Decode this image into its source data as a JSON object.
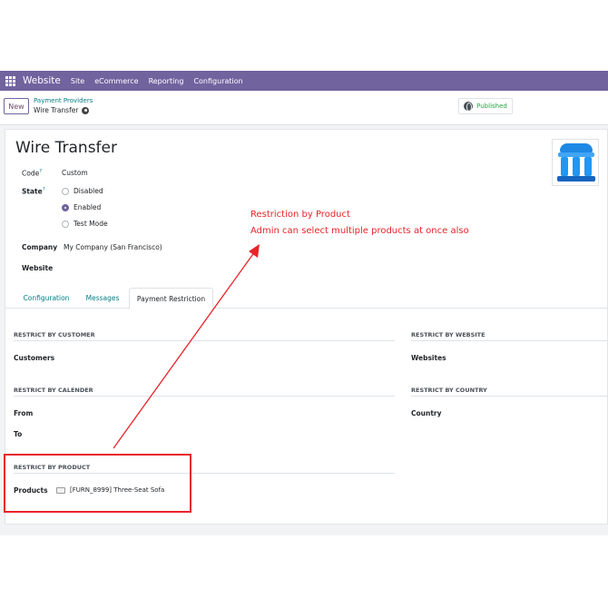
{
  "navbar": {
    "brand": "Website",
    "items": [
      "Site",
      "eCommerce",
      "Reporting",
      "Configuration"
    ]
  },
  "control": {
    "new_label": "New",
    "breadcrumb_parent": "Payment Providers",
    "breadcrumb_current": "Wire Transfer",
    "published_label": "Published"
  },
  "form": {
    "title": "Wire Transfer",
    "code_label": "Code",
    "code_value": "Custom",
    "state_label": "State",
    "state_options": [
      "Disabled",
      "Enabled",
      "Test Mode"
    ],
    "state_selected": "Enabled",
    "company_label": "Company",
    "company_value": "My Company (San Francisco)",
    "website_label": "Website",
    "help_mark": "?"
  },
  "tabs": [
    "Configuration",
    "Messages",
    "Payment Restriction"
  ],
  "active_tab": "Payment Restriction",
  "restrictions": {
    "customer": {
      "heading": "RESTRICT BY CUSTOMER",
      "field": "Customers"
    },
    "website": {
      "heading": "RESTRICT BY WEBSITE",
      "field": "Websites"
    },
    "calendar": {
      "heading": "RESTRICT BY CALENDER",
      "from": "From",
      "to": "To"
    },
    "country": {
      "heading": "RESTRICT BY COUNTRY",
      "field": "Country"
    },
    "product": {
      "heading": "RESTRICT BY PRODUCT",
      "field": "Products",
      "tag": "[FURN_8999] Three-Seat Sofa"
    }
  },
  "annotation": {
    "line1": "Restriction by Product",
    "line2": "Admin can select multiple products at once also",
    "color": "#e8232a"
  },
  "colors": {
    "navbar": "#71639e",
    "link": "#017e84",
    "published": "#28a745"
  }
}
